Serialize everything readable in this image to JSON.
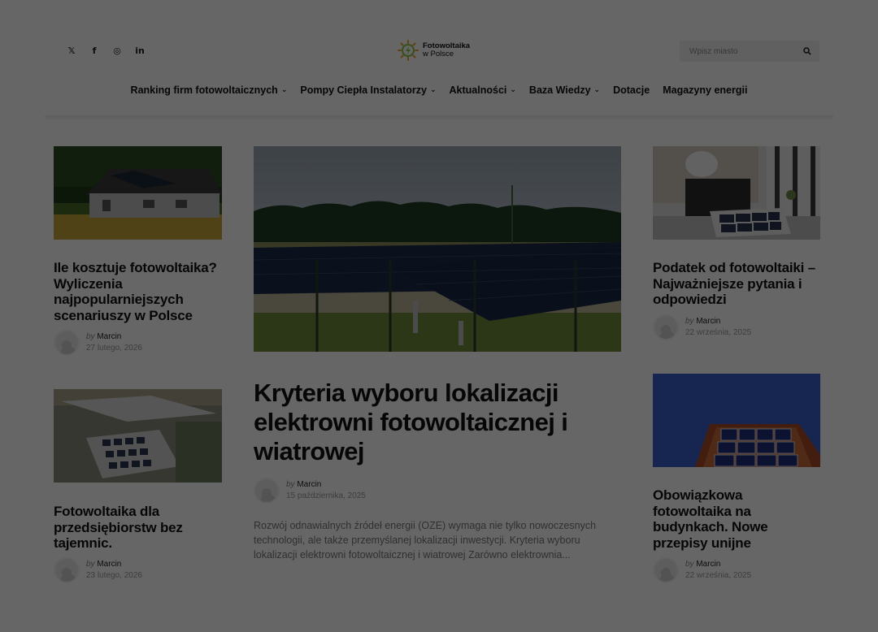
{
  "header": {
    "social": [
      {
        "icon": "x-icon",
        "glyph": "𝕏"
      },
      {
        "icon": "facebook-icon",
        "glyph": "f"
      },
      {
        "icon": "instagram-icon",
        "glyph": "◎"
      },
      {
        "icon": "linkedin-icon",
        "glyph": "in"
      }
    ],
    "logo": {
      "line1": "Fotowoltaika",
      "line2": "w Polsce"
    },
    "search": {
      "placeholder": "Wpisz miasto"
    }
  },
  "nav": [
    {
      "label": "Ranking firm fotowoltaicznych",
      "dropdown": true
    },
    {
      "label": "Pompy Ciepła Instalatorzy",
      "dropdown": true
    },
    {
      "label": "Aktualności",
      "dropdown": true
    },
    {
      "label": "Baza Wiedzy",
      "dropdown": true
    },
    {
      "label": "Dotacje",
      "dropdown": false
    },
    {
      "label": "Magazyny energii",
      "dropdown": false
    }
  ],
  "articles": {
    "left1": {
      "title": "Ile kosztuje fotowoltaika? Wyliczenia najpopularniejszych scenariuszy w Polsce",
      "by": "by",
      "author": "Marcin",
      "date": "27 lutego, 2026"
    },
    "left2": {
      "title": "Fotowoltaika dla przedsiębiorstw bez tajemnic.",
      "by": "by",
      "author": "Marcin",
      "date": "23 lutego, 2026"
    },
    "hero": {
      "title": "Kryteria wyboru lokalizacji elektrowni fotowoltaicznej i wiatrowej",
      "by": "by",
      "author": "Marcin",
      "date": "15 października, 2025",
      "excerpt": "Rozwój odnawialnych źródeł energii (OZE) wymaga nie tylko nowoczesnych technologii, ale także przemyślanej lokalizacji inwestycji. Kryteria wyboru lokalizacji elektrowni fotowoltaicznej i wiatrowej Zarówno elektrownia..."
    },
    "right1": {
      "title": "Podatek od fotowoltaiki – Najważniejsze pytania i odpowiedzi",
      "by": "by",
      "author": "Marcin",
      "date": "22 września, 2025"
    },
    "right2": {
      "title": "Obowiązkowa fotowoltaika na budynkach. Nowe przepisy unijne",
      "by": "by",
      "author": "Marcin",
      "date": "22 września, 2025"
    }
  },
  "colors": {
    "accent": "#8bc34a",
    "overlay": "rgba(0,0,0,0.6)"
  }
}
